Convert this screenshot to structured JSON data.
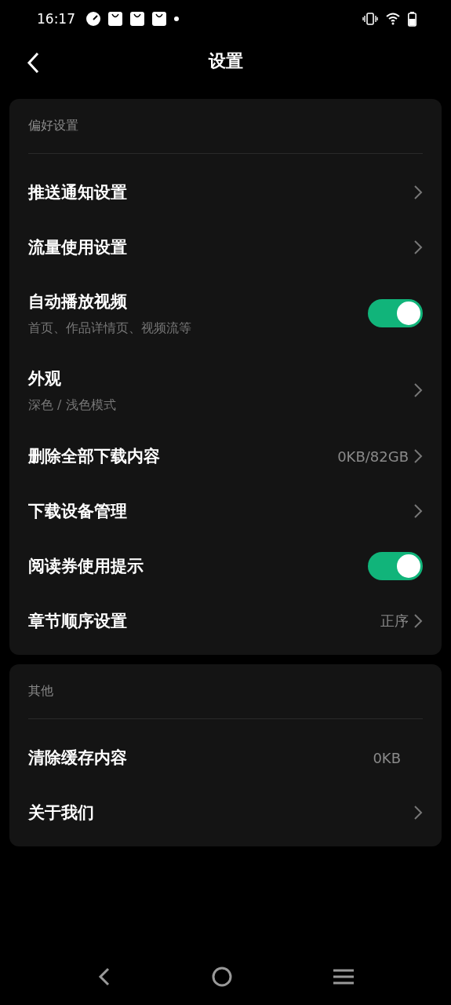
{
  "status_bar": {
    "time": "16:17"
  },
  "header": {
    "title": "设置"
  },
  "sections": [
    {
      "title": "偏好设置",
      "rows": [
        {
          "kind": "link",
          "label": "推送通知设置"
        },
        {
          "kind": "link",
          "label": "流量使用设置"
        },
        {
          "kind": "toggle",
          "label": "自动播放视频",
          "subtitle": "首页、作品详情页、视频流等",
          "on": true
        },
        {
          "kind": "link",
          "label": "外观",
          "subtitle": "深色 / 浅色模式"
        },
        {
          "kind": "link",
          "label": "删除全部下载内容",
          "value": "0KB/82GB"
        },
        {
          "kind": "link",
          "label": "下载设备管理"
        },
        {
          "kind": "toggle",
          "label": "阅读券使用提示",
          "on": true
        },
        {
          "kind": "link",
          "label": "章节顺序设置",
          "value": "正序"
        }
      ]
    },
    {
      "title": "其他",
      "rows": [
        {
          "kind": "info",
          "label": "清除缓存内容",
          "value": "0KB"
        },
        {
          "kind": "link",
          "label": "关于我们"
        }
      ]
    }
  ]
}
